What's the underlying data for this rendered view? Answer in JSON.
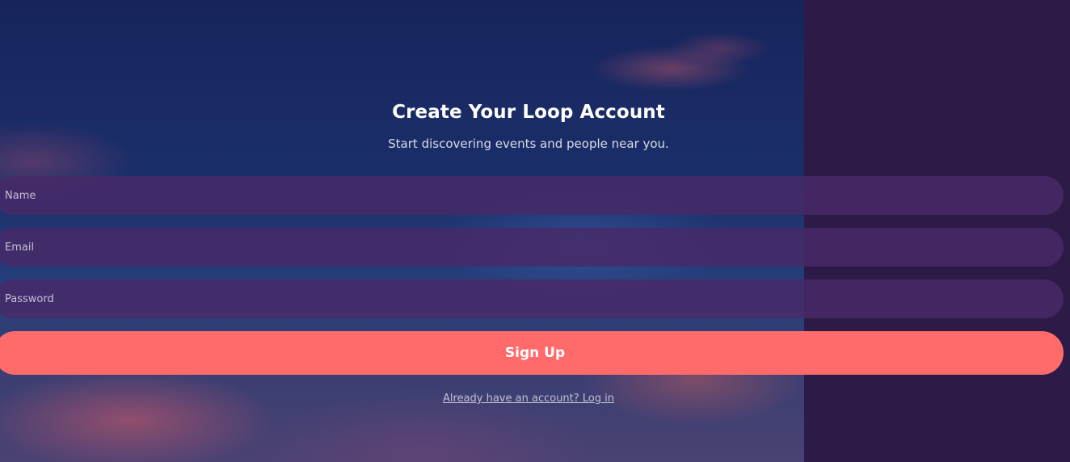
{
  "header": {
    "title": "Create Your Loop Account",
    "subtitle": "Start discovering events and people near you."
  },
  "form": {
    "name_placeholder": "Name",
    "email_placeholder": "Email",
    "password_placeholder": "Password",
    "submit_label": "Sign Up",
    "login_link": "Already have an account? Log in"
  },
  "colors": {
    "page_background": "#2d1b47",
    "field_background": "#482a68",
    "button_accent": "#ff6b6b",
    "title_text": "#ffffff",
    "link_text": "#c2c0d4"
  }
}
